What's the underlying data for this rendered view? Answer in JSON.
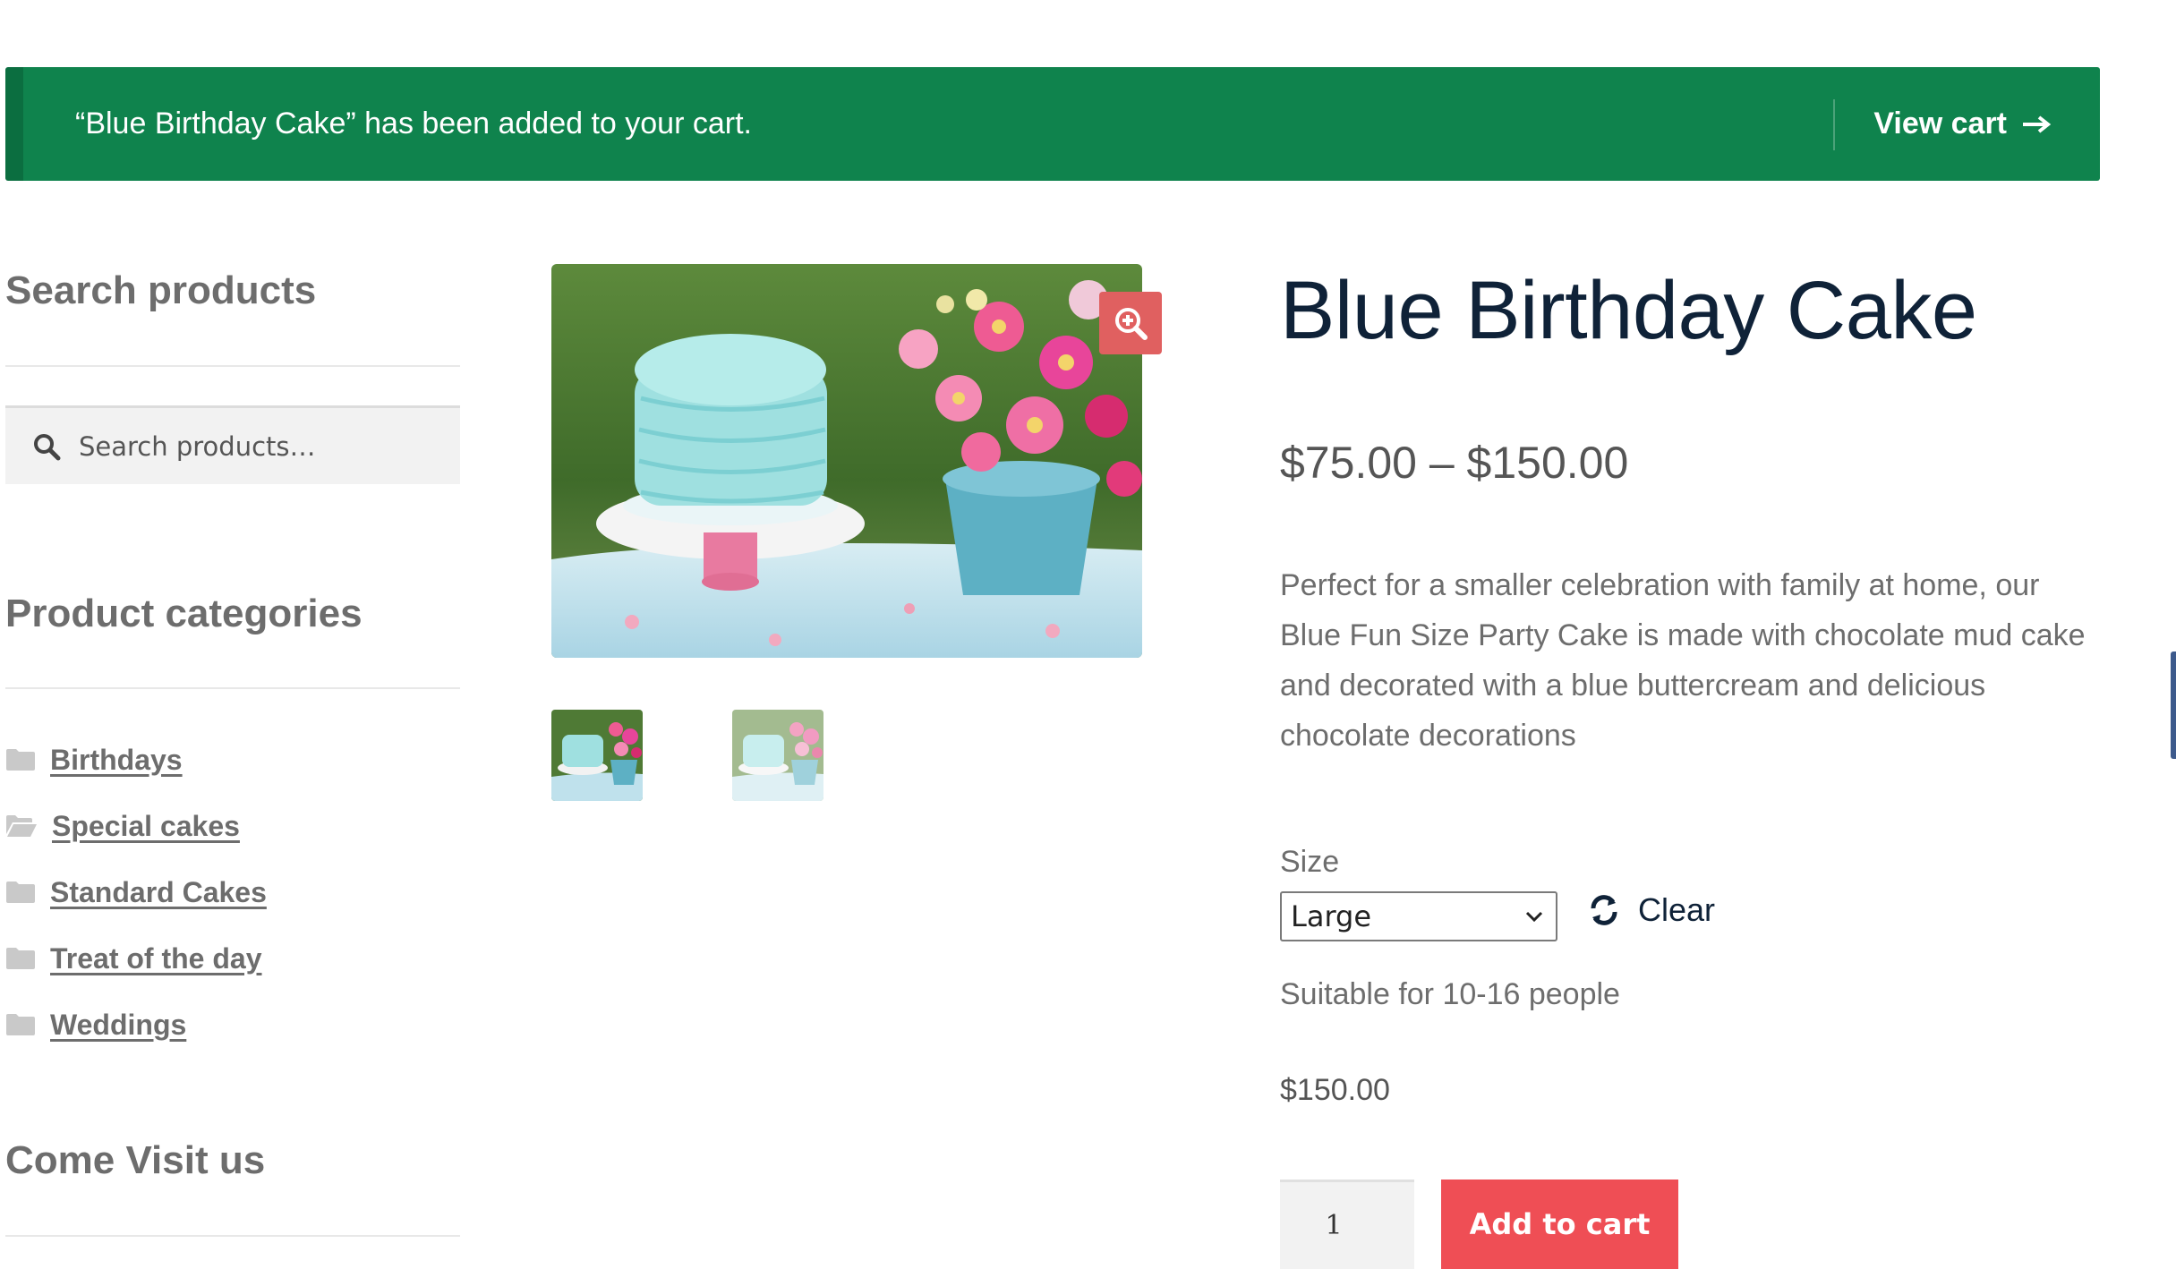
{
  "notice": {
    "message": "“Blue Birthday Cake” has been added to your cart.",
    "view_cart_label": "View cart",
    "color": "#0f834d"
  },
  "sidebar": {
    "search": {
      "title": "Search products",
      "placeholder": "Search products…",
      "icon": "search-icon"
    },
    "categories": {
      "title": "Product categories",
      "items": [
        {
          "label": "Birthdays",
          "icon": "folder-icon"
        },
        {
          "label": "Special cakes",
          "icon": "folder-open-icon"
        },
        {
          "label": "Standard Cakes",
          "icon": "folder-icon"
        },
        {
          "label": "Treat of the day",
          "icon": "folder-icon"
        },
        {
          "label": "Weddings",
          "icon": "folder-icon"
        }
      ]
    },
    "visit": {
      "title": "Come Visit us"
    }
  },
  "gallery": {
    "zoom_icon": "zoom-in-icon",
    "thumbnail_count": 2
  },
  "product": {
    "title": "Blue Birthday Cake",
    "price_range": "$75.00 – $150.00",
    "description": "Perfect for a smaller celebration with family at home, our Blue Fun Size Party Cake is made with chocolate mud cake and decorated with a blue buttercream and delicious chocolate decorations",
    "size_label": "Size",
    "size_selected": "Large",
    "clear_label": "Clear",
    "variation_description": "Suitable for 10-16 people",
    "variation_price": "$150.00",
    "quantity": "1",
    "add_to_cart_label": "Add to cart",
    "accent_color": "#ef4e55",
    "title_color": "#0f2238"
  }
}
